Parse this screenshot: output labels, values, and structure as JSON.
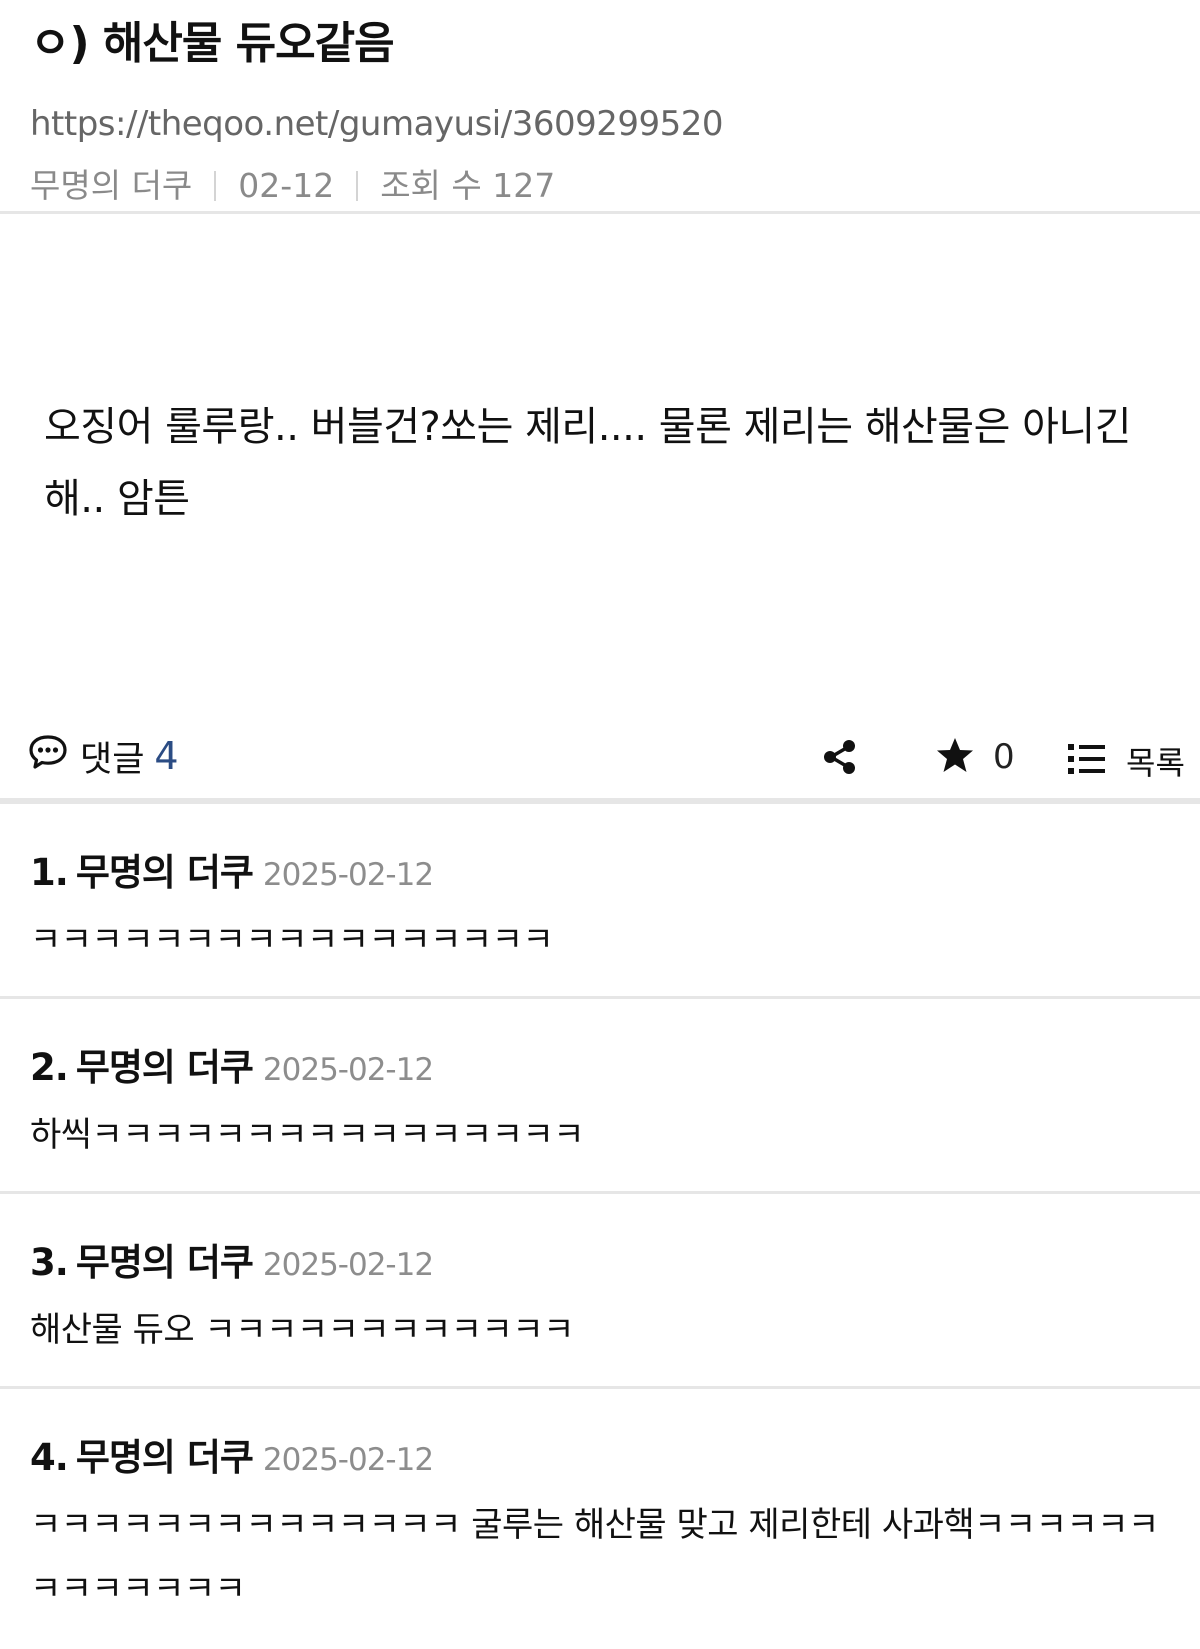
{
  "post": {
    "title": "ㅇ) 해산물 듀오같음",
    "url": "https://theqoo.net/gumayusi/3609299520",
    "author": "무명의 더쿠",
    "date": "02-12",
    "views": "조회 수 127",
    "content": "오징어 룰루랑.. 버블건?쏘는 제리.... 물론 제리는 해산물은 아니긴해.. 암튼"
  },
  "actions": {
    "comments_label": "댓글",
    "comments_count": "4",
    "star_count": "0",
    "list_label": "목록",
    "icons": [
      "comment-icon",
      "share-icon",
      "star-icon",
      "list-icon"
    ]
  },
  "comments": [
    {
      "num": "1.",
      "author": "무명의 더쿠",
      "date": "2025-02-12",
      "text": "ㅋㅋㅋㅋㅋㅋㅋㅋㅋㅋㅋㅋㅋㅋㅋㅋㅋ"
    },
    {
      "num": "2.",
      "author": "무명의 더쿠",
      "date": "2025-02-12",
      "text": "하씩ㅋㅋㅋㅋㅋㅋㅋㅋㅋㅋㅋㅋㅋㅋㅋㅋ"
    },
    {
      "num": "3.",
      "author": "무명의 더쿠",
      "date": "2025-02-12",
      "text": "해산물 듀오 ㅋㅋㅋㅋㅋㅋㅋㅋㅋㅋㅋㅋ"
    },
    {
      "num": "4.",
      "author": "무명의 더쿠",
      "date": "2025-02-12",
      "text": "ㅋㅋㅋㅋㅋㅋㅋㅋㅋㅋㅋㅋㅋㅋ 굴루는 해산물 맞고 제리한테 사과핵ㅋㅋㅋㅋㅋㅋㅋㅋㅋㅋㅋㅋㅋ"
    }
  ],
  "colors": {
    "accent": "#2b4c84",
    "meta": "#8a8a8a",
    "divider": "#e6e6e6"
  }
}
